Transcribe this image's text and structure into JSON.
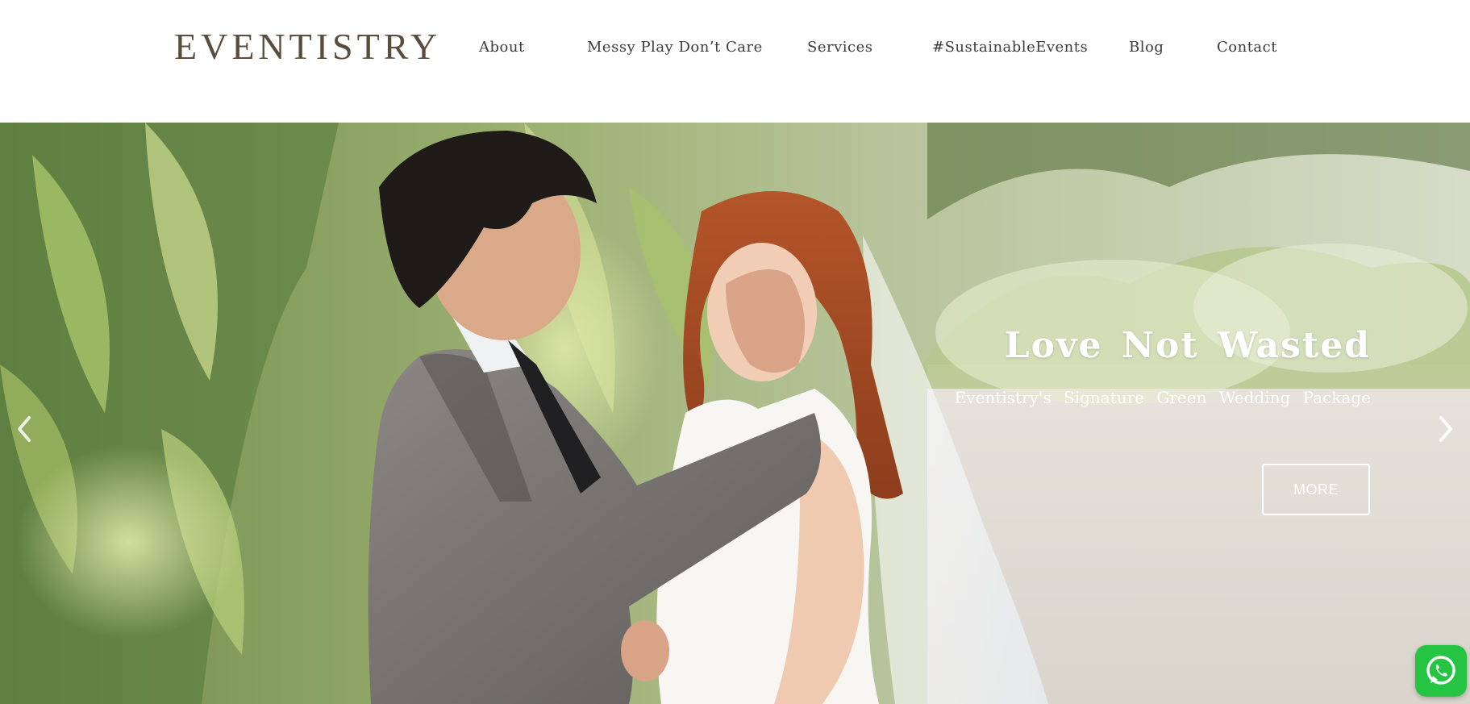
{
  "brand": {
    "logo_text": "EVENTISTRY",
    "logo_color": "#5a4d3d"
  },
  "nav": {
    "items": [
      {
        "label": "About"
      },
      {
        "label": "Messy Play Don’t Care"
      },
      {
        "label": "Services"
      },
      {
        "label": "#SustainableEvents"
      },
      {
        "label": "Blog"
      },
      {
        "label": "Contact"
      }
    ]
  },
  "hero": {
    "title": "Love Not Wasted",
    "subtitle": "Eventistry's Signature Green Wedding Package",
    "cta_label": "MORE",
    "prev_icon": "chevron-left-icon",
    "next_icon": "chevron-right-icon"
  },
  "floating": {
    "whatsapp_icon": "whatsapp-icon",
    "whatsapp_color": "#26c443"
  }
}
